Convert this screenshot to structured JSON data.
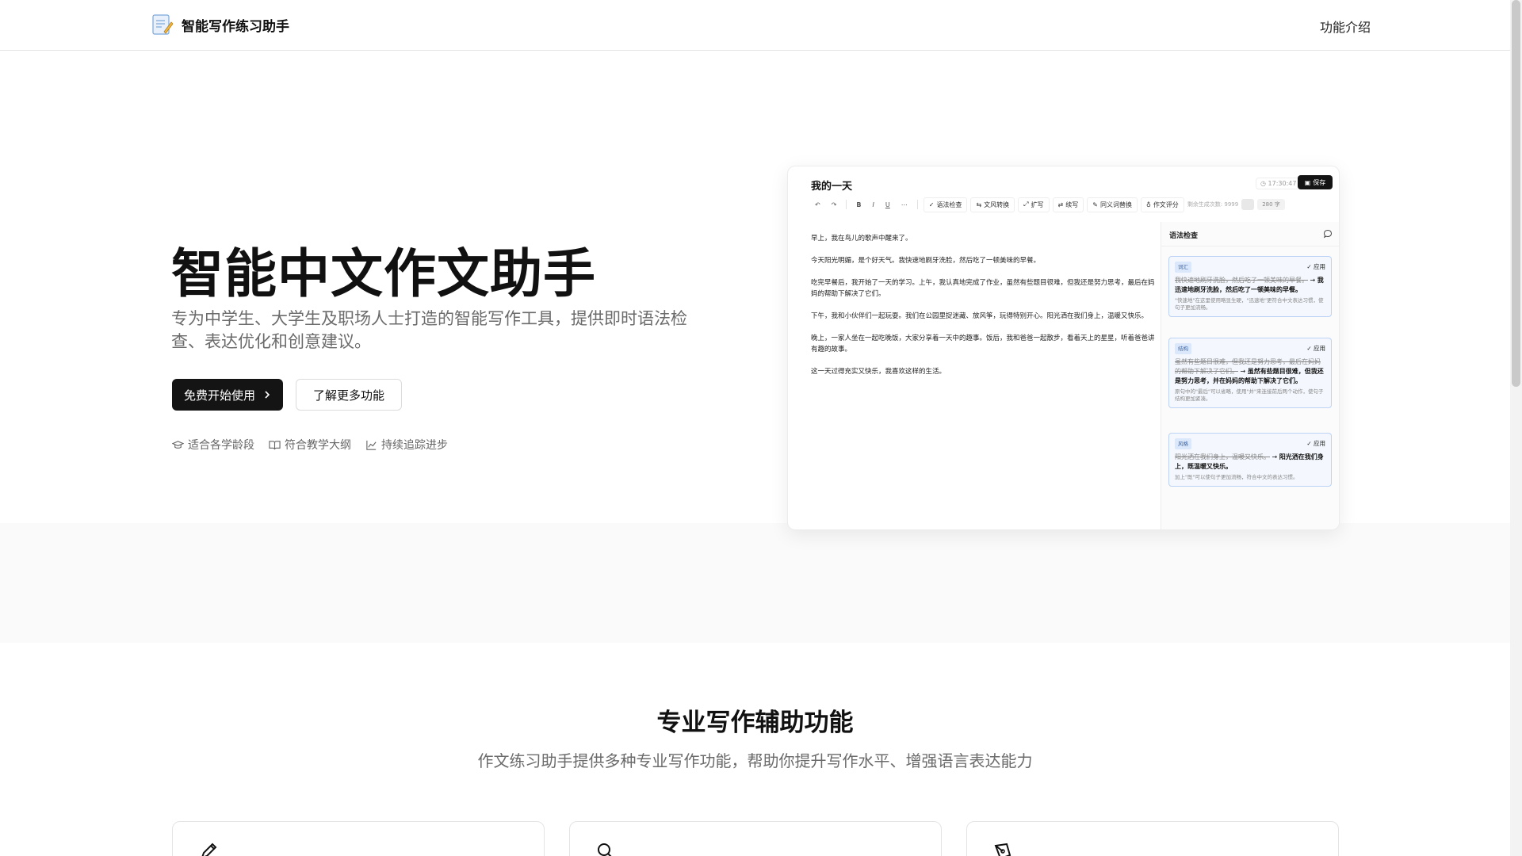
{
  "app": {
    "name": "智能写作练习助手"
  },
  "nav": {
    "about": "功能介绍"
  },
  "hero": {
    "title": "智能中文作文助手",
    "subtitle": "专为中学生、大学生及职场人士打造的智能写作工具，提供即时语法检查、表达优化和创意建议。",
    "cta_primary": "免费开始使用",
    "cta_secondary": "了解更多功能",
    "features": [
      "适合各学龄段",
      "符合教学大纲",
      "持续追踪进步"
    ]
  },
  "mock": {
    "doc_title": "我的一天",
    "time": "17:30:47",
    "save": "保存",
    "toolbar": {
      "grammar": "语法检查",
      "style": "文风转换",
      "expand": "扩写",
      "continue": "续写",
      "synonym": "同义词替换",
      "score": "作文评分",
      "remaining": "剩余生成次数: 9999",
      "count": "280 字"
    },
    "paragraphs": [
      "早上，我在鸟儿的歌声中醒来了。",
      "今天阳光明媚，是个好天气。我快速地刷牙洗脸，然后吃了一顿美味的早餐。",
      "吃完早餐后，我开始了一天的学习。上午，我认真地完成了作业，虽然有些题目很难，但我还是努力思考，最后在妈妈的帮助下解决了它们。",
      "下午，我和小伙伴们一起玩耍。我们在公园里捉迷藏、放风筝，玩得特别开心。阳光洒在我们身上，温暖又快乐。",
      "晚上，一家人坐在一起吃晚饭，大家分享着一天中的趣事。饭后，我和爸爸一起散步，看着天上的星星，听着爸爸讲有趣的故事。",
      "这一天过得充实又快乐，我喜欢这样的生活。"
    ],
    "side_title": "语法检查",
    "apply": "应用",
    "suggestions": [
      {
        "tag": "词汇",
        "old": "我快速地刷牙洗脸，然后吃了一顿美味的早餐。",
        "new": "我迅速地刷牙洗脸，然后吃了一顿美味的早餐。",
        "note": "\"快速地\"在这里使用略显生硬，\"迅速地\"更符合中文表达习惯，使句子更加流畅。"
      },
      {
        "tag": "结构",
        "old": "虽然有些题目很难，但我还是努力思考，最后在妈妈的帮助下解决了它们。",
        "new": "虽然有些题目很难，但我还是努力思考，并在妈妈的帮助下解决了它们。",
        "note": "原句中的\"最后\"可以省略，使用\"并\"来连接前后两个动作，使句子结构更加紧凑。"
      },
      {
        "tag": "风格",
        "old": "阳光洒在我们身上，温暖又快乐。",
        "new": "阳光洒在我们身上，既温暖又快乐。",
        "note": "加上\"既\"可以使句子更加流畅，符合中文的表达习惯。"
      }
    ]
  },
  "section": {
    "title": "专业写作辅助功能",
    "subtitle": "作文练习助手提供多种专业写作功能，帮助你提升写作水平、增强语言表达能力"
  }
}
